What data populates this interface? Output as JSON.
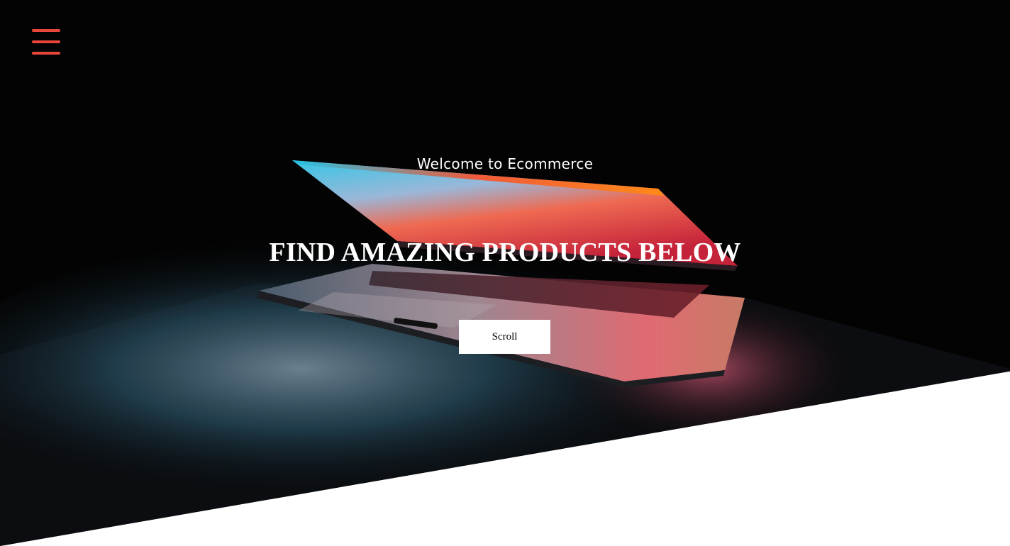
{
  "header": {
    "menu_icon": "hamburger-menu-icon",
    "menu_color": "#e8463a"
  },
  "hero": {
    "welcome_text": "Welcome to Ecommerce",
    "headline": "FIND AMAZING PRODUCTS BELOW",
    "scroll_label": "Scroll",
    "background_image": "laptop-glow-photo"
  },
  "colors": {
    "background_dark": "#030303",
    "text": "#ffffff",
    "button_bg": "#ffffff",
    "accent": "#e8463a"
  }
}
